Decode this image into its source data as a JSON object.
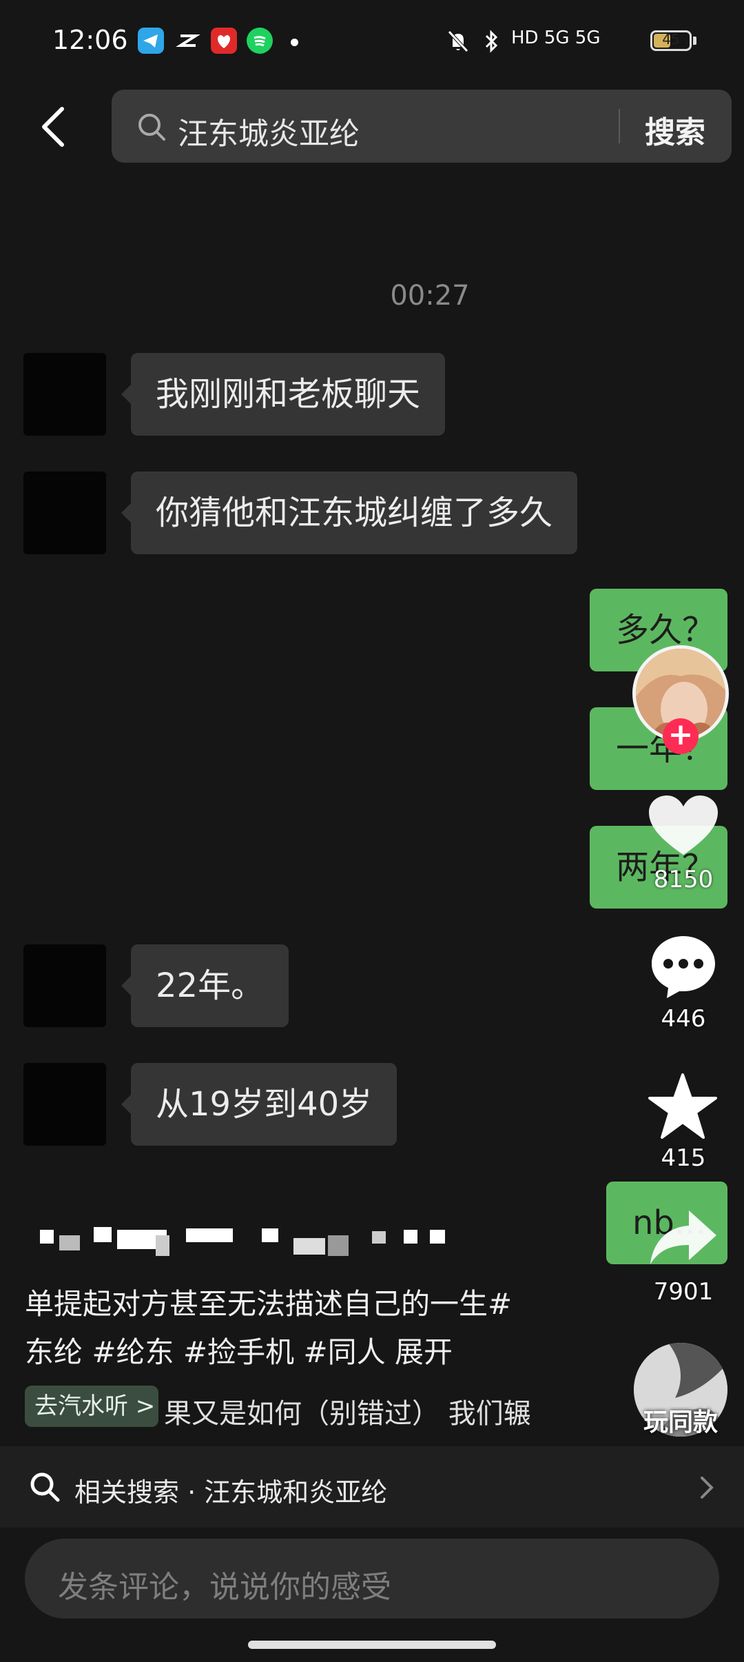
{
  "status_bar": {
    "time": "12:06",
    "network": "HD 5G 5G",
    "battery": "45"
  },
  "search": {
    "query": "汪东城炎亚纶",
    "button_label": "搜索"
  },
  "chat": {
    "timestamp": "00:27",
    "messages": [
      {
        "side": "left",
        "text": "我刚刚和老板聊天"
      },
      {
        "side": "left",
        "text": "你猜他和汪东城纠缠了多久"
      },
      {
        "side": "right",
        "text": "多久？"
      },
      {
        "side": "right",
        "text": "一年？"
      },
      {
        "side": "right",
        "text": "两年？"
      },
      {
        "side": "left",
        "text": "22年。"
      },
      {
        "side": "left",
        "text": "从19岁到40岁"
      },
      {
        "side": "right",
        "text": "nb..."
      }
    ]
  },
  "actions": {
    "likes": "8150",
    "comments": "446",
    "favorites": "415",
    "shares": "7901"
  },
  "caption": {
    "line1": "单提起对方甚至无法描述自己的一生#",
    "line2": "东纶 #纶东 #捡手机 #同人 展开"
  },
  "music": {
    "tag": "去汽水听 >",
    "text": "果又是如何（别错过）  我们辗"
  },
  "remix": {
    "label": "玩同款"
  },
  "related_search": {
    "label": "相关搜索 · 汪东城和炎亚纶"
  },
  "comment": {
    "placeholder": "发条评论，说说你的感受"
  },
  "colors": {
    "background": "#161616",
    "bubble_in": "#353535",
    "bubble_out": "#5cb860",
    "follow": "#fe2c55"
  }
}
